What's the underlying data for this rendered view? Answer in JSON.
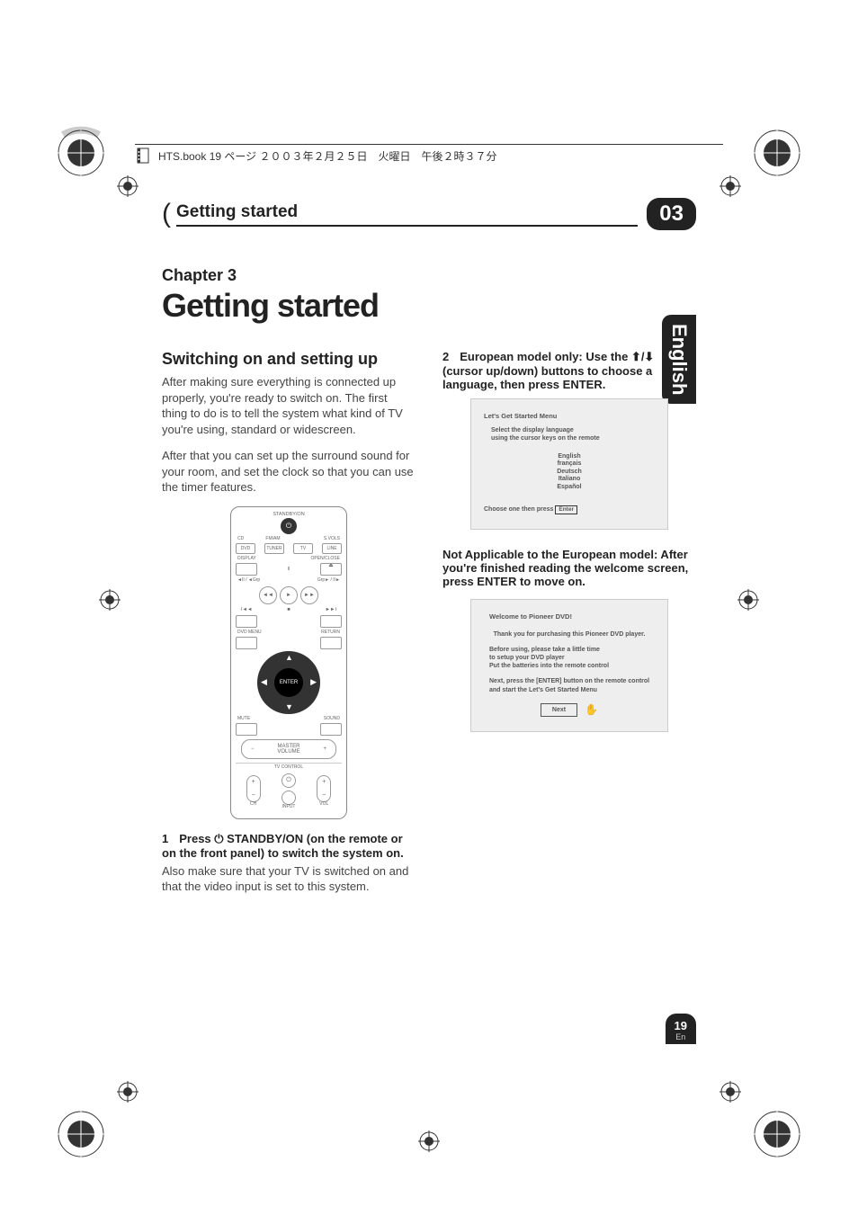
{
  "print_header": "HTS.book  19 ページ  ２００３年２月２５日　火曜日　午後２時３７分",
  "header": {
    "title": "Getting started",
    "tab": "03"
  },
  "side_tab": "English",
  "chapter": {
    "label": "Chapter 3",
    "title": "Getting started"
  },
  "section": {
    "title": "Switching on and setting up",
    "p1": "After making sure everything is connected up properly, you're ready to switch on. The first thing to do is to tell the system what kind of TV you're using, standard or widescreen.",
    "p2": "After that you can set up the surround sound for your room, and set the clock so that you can use the timer features."
  },
  "remote": {
    "standby_label": "STANDBY/ON",
    "inputs": {
      "cd": "CD",
      "fmam": "FM/AM",
      "s_vols": "S.VOLS",
      "dvd": "DVD",
      "tuner": "TUNER",
      "tv": "TV",
      "line": "LINE"
    },
    "display": "DISPLAY",
    "open_close": "OPEN/CLOSE",
    "prev_grp": "◄II / ◄Grp",
    "next_grp": "Grp► / II►",
    "dvd_menu": "DVD MENU",
    "return": "RETURN",
    "enter": "ENTER",
    "mute": "MUTE",
    "sound": "SOUND",
    "master_vol": "MASTER\nVOLUME",
    "tv_control": "TV  CONTROL",
    "ch": "CH",
    "input": "INPUT",
    "vol": "VOL",
    "play": "►",
    "pause": "II",
    "stop": "■",
    "rew": "◄◄",
    "ffw": "►►",
    "skipb": "I◄◄",
    "skipf": "►►I"
  },
  "step1": {
    "num": "1",
    "bold": "Press ⏻ STANDBY/ON (on the remote or on the front panel) to switch the system on.",
    "body": "Also make sure that your TV is switched on and that the video input is set to this system."
  },
  "step2": {
    "num": "2",
    "bold": "European model only: Use the ⬆/⬇ (cursor up/down) buttons to choose a language, then press ENTER."
  },
  "screen1": {
    "title": "Let's Get Started Menu",
    "sub": "Select the display language\nusing the cursor keys on the remote",
    "langs": [
      "English",
      "français",
      "Deutsch",
      "Italiano",
      "Español"
    ],
    "foot_prefix": "Choose one then press",
    "foot_btn": "Enter"
  },
  "step3": {
    "bold": "Not Applicable to the European model: After you're finished reading the welcome screen, press ENTER to move on."
  },
  "screen2": {
    "title": "Welcome to Pioneer DVD!",
    "line1": "Thank you for purchasing this Pioneer DVD player.",
    "line2": "Before using, please take a little time\nto setup your DVD player\nPut the batteries into the remote control",
    "line3": "Next, press the [ENTER] button on the remote control\nand start the Let's Get Started Menu",
    "next": "Next"
  },
  "page_number": {
    "num": "19",
    "lang": "En"
  }
}
